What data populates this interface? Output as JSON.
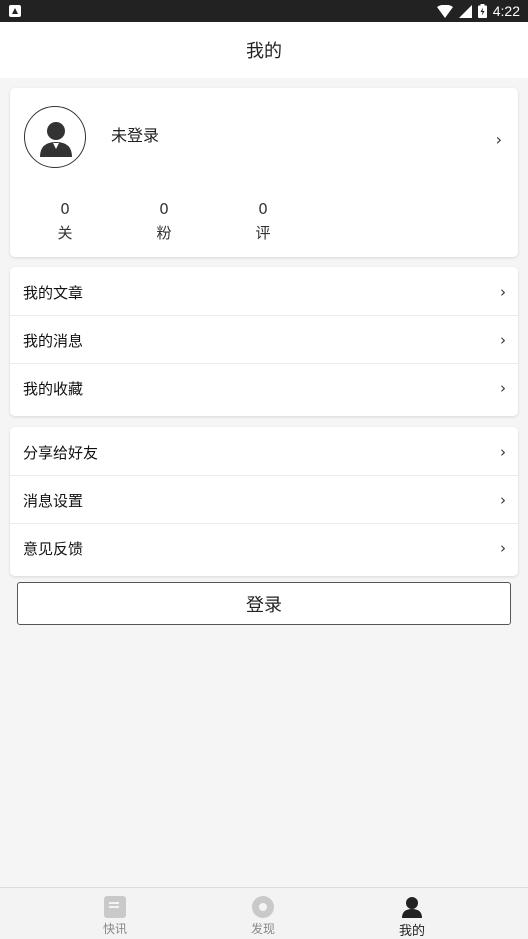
{
  "status_bar": {
    "time": "4:22",
    "icons": [
      "notification-icon",
      "wifi-icon",
      "cell-signal-icon",
      "battery-icon"
    ]
  },
  "header": {
    "title": "我的"
  },
  "profile": {
    "name": "未登录",
    "avatar_icon": "user-avatar-icon",
    "chevron": "›",
    "stats": [
      {
        "value": "0",
        "label": "关"
      },
      {
        "value": "0",
        "label": "粉"
      },
      {
        "value": "0",
        "label": "评"
      }
    ]
  },
  "menu_group_1": [
    {
      "label": "我的文章",
      "chevron": "›"
    },
    {
      "label": "我的消息",
      "chevron": "›"
    },
    {
      "label": "我的收藏",
      "chevron": "›"
    }
  ],
  "menu_group_2": [
    {
      "label": "分享给好友",
      "chevron": "›"
    },
    {
      "label": "消息设置",
      "chevron": "›"
    },
    {
      "label": "意见反馈",
      "chevron": "›"
    }
  ],
  "login_button": {
    "label": "登录"
  },
  "bottom_nav": [
    {
      "label": "快讯",
      "icon": "news-icon",
      "active": false
    },
    {
      "label": "发现",
      "icon": "discover-icon",
      "active": false
    },
    {
      "label": "我的",
      "icon": "profile-icon",
      "active": true
    }
  ],
  "colors": {
    "accent": "#222222",
    "inactive": "#888888",
    "background": "#f5f5f5"
  }
}
